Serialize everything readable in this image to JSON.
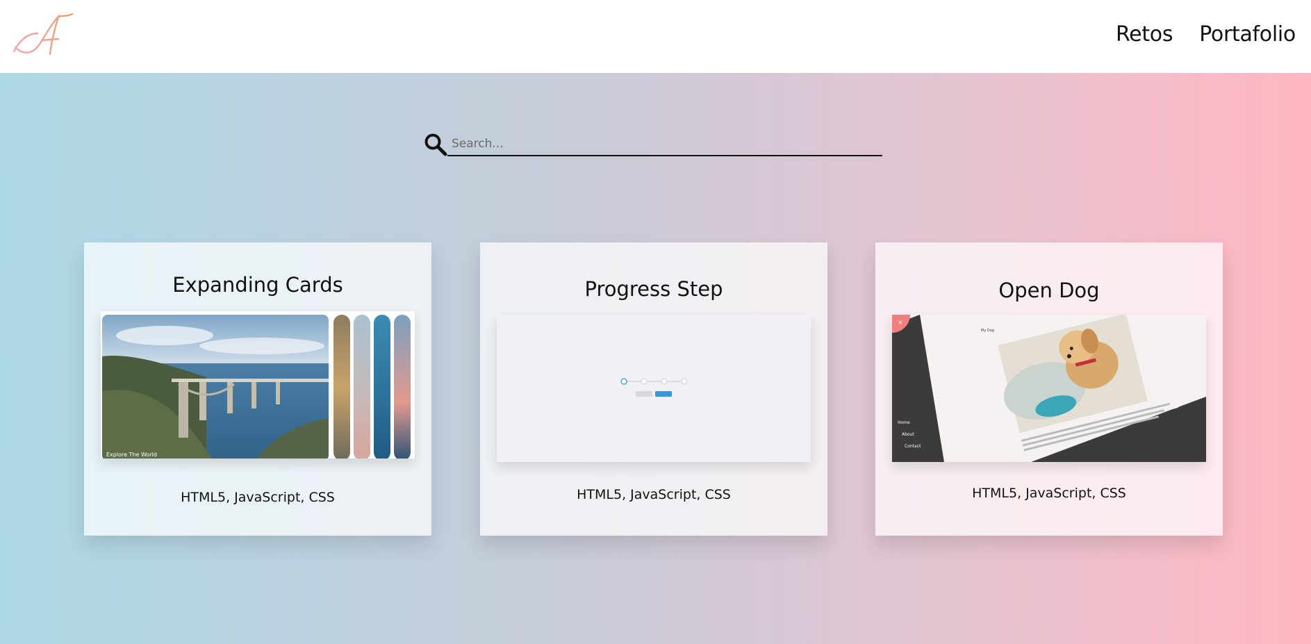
{
  "header": {
    "logo_icon": "script-letter-a-logo",
    "nav": [
      "Retos",
      "Portafolio"
    ]
  },
  "search": {
    "placeholder": "Search...",
    "icon": "search-icon"
  },
  "colors": {
    "gradient_start": "#add8e6",
    "gradient_end": "#ffb6c1",
    "progress_accent": "#3498db",
    "dog_close": "#f08080"
  },
  "cards": [
    {
      "title": "Expanding Cards",
      "tech": "HTML5, JavaScript, CSS",
      "preview_caption": "Explore The World"
    },
    {
      "title": "Progress Step",
      "tech": "HTML5, JavaScript, CSS",
      "preview": {
        "steps": [
          "1",
          "2",
          "3",
          "4"
        ],
        "prev_label": "Prev",
        "next_label": "Next"
      }
    },
    {
      "title": "Open Dog",
      "tech": "HTML5, JavaScript, CSS",
      "preview": {
        "close_label": "×",
        "menu": [
          "Home",
          "About",
          "Contact"
        ],
        "heading": "My Dog"
      }
    }
  ]
}
